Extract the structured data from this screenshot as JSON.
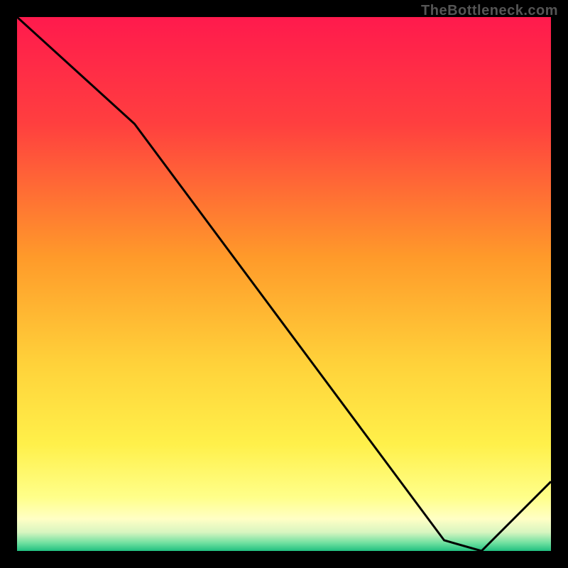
{
  "watermark": "TheBottleneck.com",
  "chart_data": {
    "type": "line",
    "x": [
      0.0,
      0.22,
      0.8,
      0.87,
      1.0
    ],
    "values": [
      1.0,
      0.8,
      0.02,
      0.0,
      0.13
    ],
    "title": "",
    "xlabel": "",
    "ylabel": "",
    "xlim": [
      0,
      1
    ],
    "ylim": [
      0,
      1
    ],
    "background_gradient": {
      "stops": [
        {
          "offset": 0.0,
          "color": "#ff1a4d"
        },
        {
          "offset": 0.2,
          "color": "#ff3f3f"
        },
        {
          "offset": 0.45,
          "color": "#ff9a2a"
        },
        {
          "offset": 0.65,
          "color": "#ffd23a"
        },
        {
          "offset": 0.8,
          "color": "#fff04a"
        },
        {
          "offset": 0.9,
          "color": "#ffff8a"
        },
        {
          "offset": 0.94,
          "color": "#ffffc5"
        },
        {
          "offset": 0.965,
          "color": "#d8f5c0"
        },
        {
          "offset": 0.985,
          "color": "#6fe0a0"
        },
        {
          "offset": 1.0,
          "color": "#20c080"
        }
      ]
    },
    "annotations": [
      {
        "text": "",
        "position": {
          "x": 0.8,
          "y": 0.02
        }
      }
    ],
    "border_px": 24
  },
  "annotation_text": ""
}
